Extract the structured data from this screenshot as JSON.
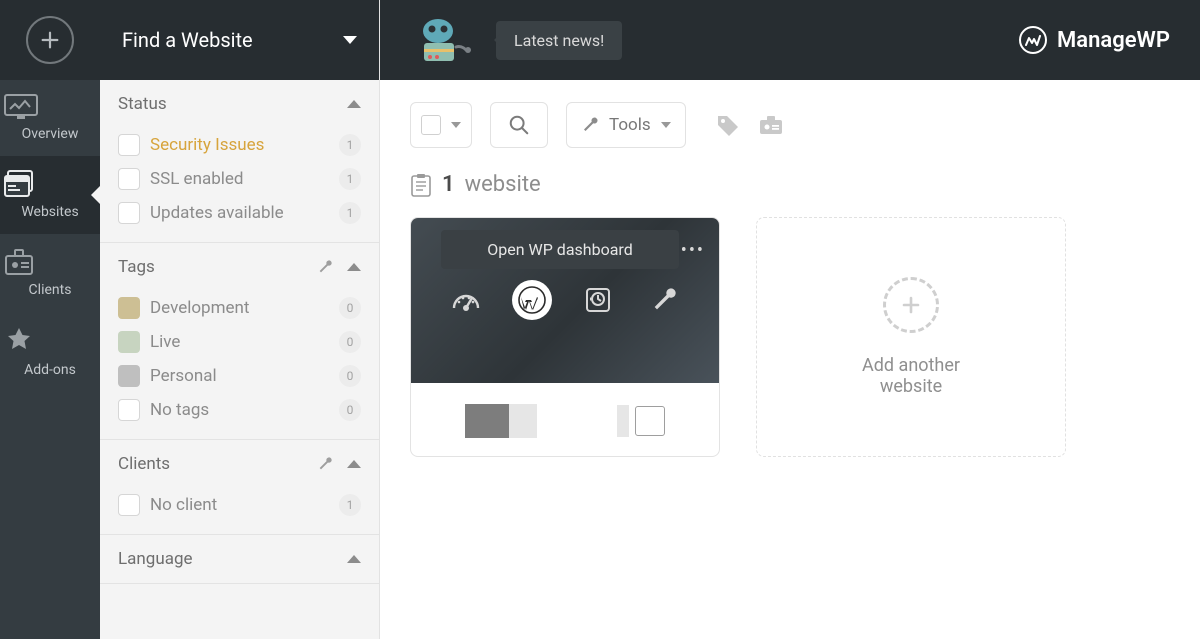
{
  "brand": {
    "name": "ManageWP"
  },
  "topbar": {
    "news_label": "Latest news!"
  },
  "rail": {
    "items": [
      {
        "label": "Overview"
      },
      {
        "label": "Websites"
      },
      {
        "label": "Clients"
      },
      {
        "label": "Add-ons"
      }
    ]
  },
  "filters": {
    "title": "Find a Website",
    "status": {
      "title": "Status",
      "items": [
        {
          "label": "Security Issues",
          "count": "1",
          "warn": true
        },
        {
          "label": "SSL enabled",
          "count": "1"
        },
        {
          "label": "Updates available",
          "count": "1"
        }
      ]
    },
    "tags": {
      "title": "Tags",
      "items": [
        {
          "label": "Development",
          "count": "0",
          "swatch": "#cdbf94"
        },
        {
          "label": "Live",
          "count": "0",
          "swatch": "#c7d4c0"
        },
        {
          "label": "Personal",
          "count": "0",
          "swatch": "#bfbfbf"
        },
        {
          "label": "No tags",
          "count": "0",
          "swatch": null
        }
      ]
    },
    "clients": {
      "title": "Clients",
      "items": [
        {
          "label": "No client",
          "count": "1"
        }
      ]
    },
    "language": {
      "title": "Language"
    }
  },
  "toolbar": {
    "tools_label": "Tools"
  },
  "main": {
    "count_number": "1",
    "count_word": "website",
    "card_tooltip": "Open WP dashboard",
    "add_card_line1": "Add another",
    "add_card_line2": "website"
  }
}
